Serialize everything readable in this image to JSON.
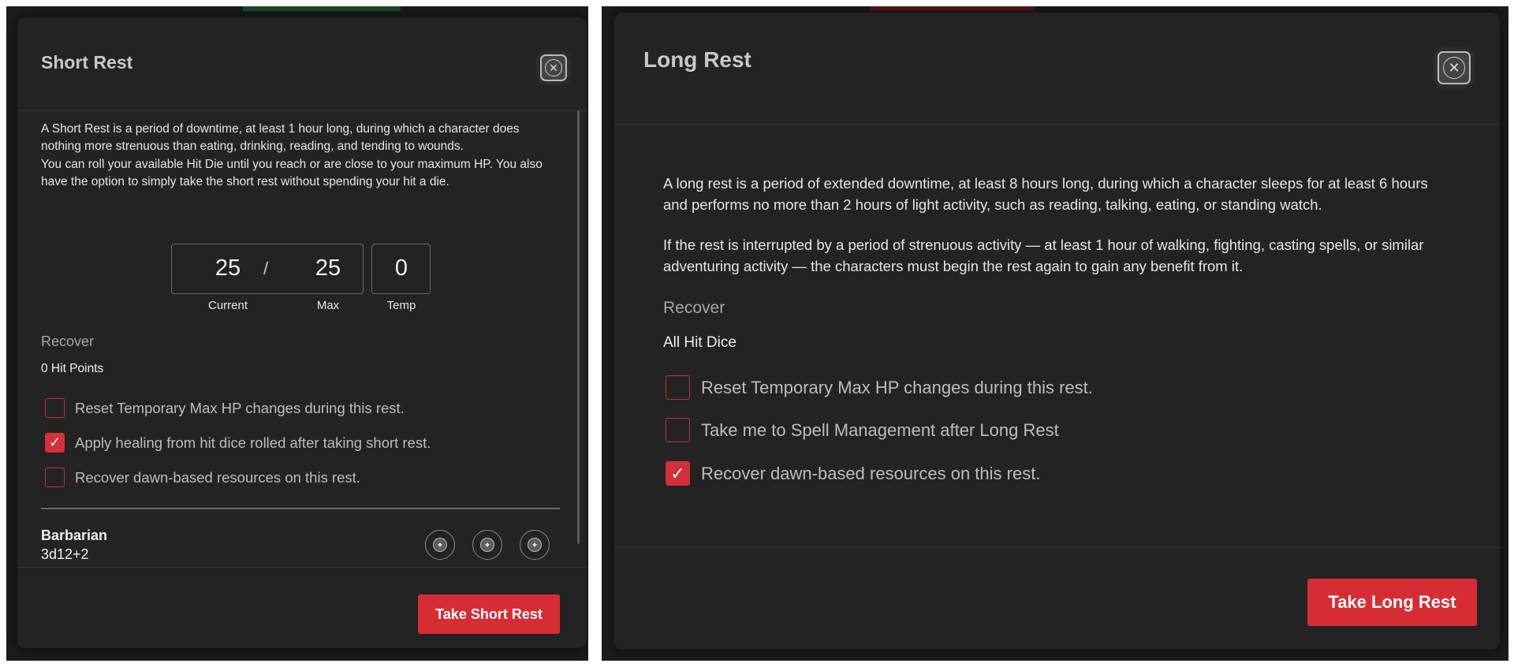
{
  "short_rest": {
    "title": "Short Rest",
    "close_glyph": "✕",
    "intro": "A Short Rest is a period of downtime, at least 1 hour long, during which a character does nothing more strenuous than eating, drinking, reading, and tending to wounds.",
    "hit_die_note": "You can roll your available Hit Die until you reach or are close to your maximum HP. You also have the option to simply take the short rest without spending your hit a die.",
    "hp": {
      "current": "25",
      "slash": "/",
      "max": "25",
      "temp": "0",
      "current_label": "Current",
      "max_label": "Max",
      "temp_label": "Temp"
    },
    "recover_heading": "Recover",
    "recover_value": "0 Hit Points",
    "options": [
      {
        "label": "Reset Temporary Max HP changes during this rest.",
        "checked": false
      },
      {
        "label": "Apply healing from hit dice rolled after taking short rest.",
        "checked": true
      },
      {
        "label": "Recover dawn-based resources on this rest.",
        "checked": false
      }
    ],
    "class_name": "Barbarian",
    "class_dice": "3d12+2",
    "dice_icons": [
      "d12-icon",
      "d12-icon",
      "d12-icon"
    ],
    "submit_label": "Take Short Rest"
  },
  "long_rest": {
    "title": "Long Rest",
    "close_glyph": "✕",
    "intro": "A long rest is a period of extended downtime, at least 8 hours long, during which a character sleeps for at least 6 hours and performs no more than 2 hours of light activity, such as reading, talking, eating, or standing watch.",
    "interruption_note": "If the rest is interrupted by a period of strenuous activity — at least 1 hour of walking, fighting, casting spells, or similar adventuring activity — the characters must begin the rest again to gain any benefit from it.",
    "recover_heading": "Recover",
    "recover_value": "All Hit Dice",
    "options": [
      {
        "label": "Reset Temporary Max HP changes during this rest.",
        "checked": false
      },
      {
        "label": "Take me to Spell Management after Long Rest",
        "checked": false
      },
      {
        "label": "Recover dawn-based resources on this rest.",
        "checked": true
      }
    ],
    "submit_label": "Take Long Rest"
  },
  "colors": {
    "accent": "#d62d35",
    "modal_bg": "#232323",
    "backdrop": "#1c1c1c"
  }
}
